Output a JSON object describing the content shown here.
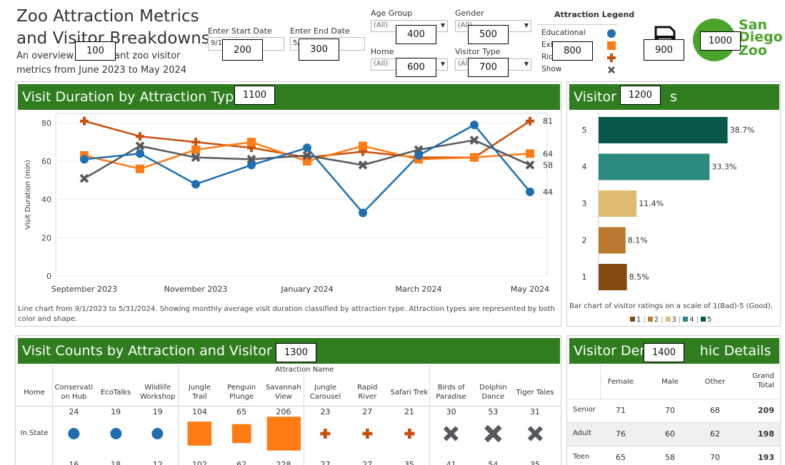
{
  "header": {
    "title_line1": "Zoo Attraction Metrics",
    "title_line2": "and Visitor Breakdowns",
    "subtitle_line1_start": "An overview",
    "subtitle_line1_end": "ant zoo visitor",
    "subtitle_line2": "metrics from June 2023 to May 2024"
  },
  "filters": {
    "start_label": "Enter Start Date",
    "start_value": "9/1",
    "end_label": "Enter End Date",
    "end_value": "5/",
    "age_label": "Age Group",
    "age_value": "(All)",
    "gender_label": "Gender",
    "gender_value": "(All)",
    "home_label": "Home",
    "home_value": "(All)",
    "visitor_type_label": "Visitor Type",
    "visitor_type_value": "(All)"
  },
  "legend": {
    "title": "Attraction Legend",
    "items": [
      {
        "label": "Educational",
        "shape": "circle-icon",
        "color": "#1f6fb0"
      },
      {
        "label": "Exh",
        "shape": "square-icon",
        "color": "#ff7b14"
      },
      {
        "label": "Rid",
        "shape": "plus-icon",
        "color": "#c8500a"
      },
      {
        "label": "Show",
        "shape": "x-icon",
        "color": "#56595e"
      }
    ]
  },
  "logo": {
    "line1": "San",
    "line2": "Diego",
    "line3": "Zoo"
  },
  "overlays": [
    "100",
    "200",
    "300",
    "400",
    "500",
    "600",
    "700",
    "800",
    "900",
    "1000",
    "1100",
    "1200",
    "1300",
    "1400"
  ],
  "visit_duration": {
    "title": "Visit Duration by Attraction Type",
    "note": "Line chart from 9/1/2023 to 5/31/2024. Showing monthly average visit duration classified by attraction type. Attraction types are represented by both color and shape.",
    "chart_data": {
      "type": "line",
      "ylabel": "Visit Duration (min)",
      "ylim": [
        0,
        85
      ],
      "yticks": [
        0,
        20,
        40,
        60,
        80
      ],
      "x": [
        "2023-09",
        "2023-10",
        "2023-11",
        "2023-12",
        "2024-01",
        "2024-02",
        "2024-03",
        "2024-04",
        "2024-05"
      ],
      "xtick_labels": [
        "September 2023",
        "November 2023",
        "January 2024",
        "March 2024",
        "May 2024"
      ],
      "xtick_index": [
        0,
        2,
        4,
        6,
        8
      ],
      "series": [
        {
          "name": "Ride",
          "color": "#c8500a",
          "shape": "plus",
          "values": [
            81,
            73,
            70,
            67,
            62,
            65,
            62,
            62,
            81
          ],
          "end_label": "81"
        },
        {
          "name": "Exhibit",
          "color": "#ff7b14",
          "shape": "square",
          "values": [
            63,
            56,
            66,
            70,
            60,
            68,
            61,
            62,
            64
          ],
          "end_label": "64"
        },
        {
          "name": "Show",
          "color": "#56595e",
          "shape": "x",
          "values": [
            51,
            68,
            62,
            61,
            63,
            58,
            66,
            71,
            58
          ],
          "end_label": "58"
        },
        {
          "name": "Educational",
          "color": "#1f6fb0",
          "shape": "circle",
          "values": [
            61,
            64,
            48,
            58,
            67,
            33,
            63,
            79,
            44
          ],
          "end_label": "44"
        }
      ]
    }
  },
  "ratings": {
    "title_start": "Visitor R",
    "title_end": "s",
    "note": "Bar chart of visitor ratings on a scale of 1(Bad)-5 (Good).",
    "legend": [
      "1",
      "2",
      "3",
      "4",
      "5"
    ],
    "chart_data": {
      "type": "bar",
      "orientation": "horizontal",
      "categories": [
        "5",
        "4",
        "3",
        "2",
        "1"
      ],
      "values": [
        38.7,
        33.3,
        11.4,
        8.1,
        8.5
      ],
      "labels": [
        "38.7%",
        "33.3%",
        "11.4%",
        "8.1%",
        "8.5%"
      ],
      "colors": [
        "#08574b",
        "#2a8a80",
        "#dfbc72",
        "#b9792f",
        "#844a10"
      ],
      "xlim": [
        0,
        45
      ]
    }
  },
  "visit_counts": {
    "title_start": "Visit Counts by Attraction and Visitor Hom",
    "group_header": "Attraction Name",
    "row_header": "Home",
    "columns": [
      {
        "name": "Conservati on Hub",
        "l1": "Conservati",
        "l2": "on Hub",
        "type": "circle"
      },
      {
        "name": "EcoTalks",
        "l1": "EcoTalks",
        "l2": "",
        "type": "circle"
      },
      {
        "name": "Wildlife Workshop",
        "l1": "Wildlife",
        "l2": "Workshop",
        "type": "circle"
      },
      {
        "name": "Jungle Trail",
        "l1": "Jungle",
        "l2": "Trail",
        "type": "square"
      },
      {
        "name": "Penguin Plunge",
        "l1": "Penguin",
        "l2": "Plunge",
        "type": "square"
      },
      {
        "name": "Savannah View",
        "l1": "Savannah",
        "l2": "View",
        "type": "square"
      },
      {
        "name": "Jungle Carousel",
        "l1": "Jungle",
        "l2": "Carousel",
        "type": "plus"
      },
      {
        "name": "Rapid River",
        "l1": "Rapid",
        "l2": "River",
        "type": "plus"
      },
      {
        "name": "Safari Trek",
        "l1": "Safari Trek",
        "l2": "",
        "type": "plus"
      },
      {
        "name": "Birds of Paradise",
        "l1": "Birds of",
        "l2": "Paradise",
        "type": "x"
      },
      {
        "name": "Dolphin Dance",
        "l1": "Dolphin",
        "l2": "Dance",
        "type": "x"
      },
      {
        "name": "Tiger Tales",
        "l1": "Tiger Tales",
        "l2": "",
        "type": "x"
      }
    ],
    "rows": [
      {
        "label": "In State",
        "values": [
          "24",
          "19",
          "19",
          "104",
          "65",
          "206",
          "23",
          "27",
          "21",
          "30",
          "53",
          "31"
        ]
      },
      {
        "label": "",
        "values": [
          "16",
          "18",
          "12",
          "102",
          "62",
          "228",
          "27",
          "27",
          "35",
          "41",
          "54",
          "35"
        ]
      }
    ]
  },
  "demographics": {
    "title_start": "Visitor Dem",
    "title_end": "hic Details",
    "columns": [
      "Female",
      "Male",
      "Other",
      "Grand Total"
    ],
    "rows": [
      {
        "label": "Senior",
        "values": [
          "71",
          "70",
          "68",
          "209"
        ]
      },
      {
        "label": "Adult",
        "values": [
          "76",
          "60",
          "62",
          "198"
        ]
      },
      {
        "label": "Teen",
        "values": [
          "65",
          "58",
          "70",
          "193"
        ]
      }
    ]
  }
}
